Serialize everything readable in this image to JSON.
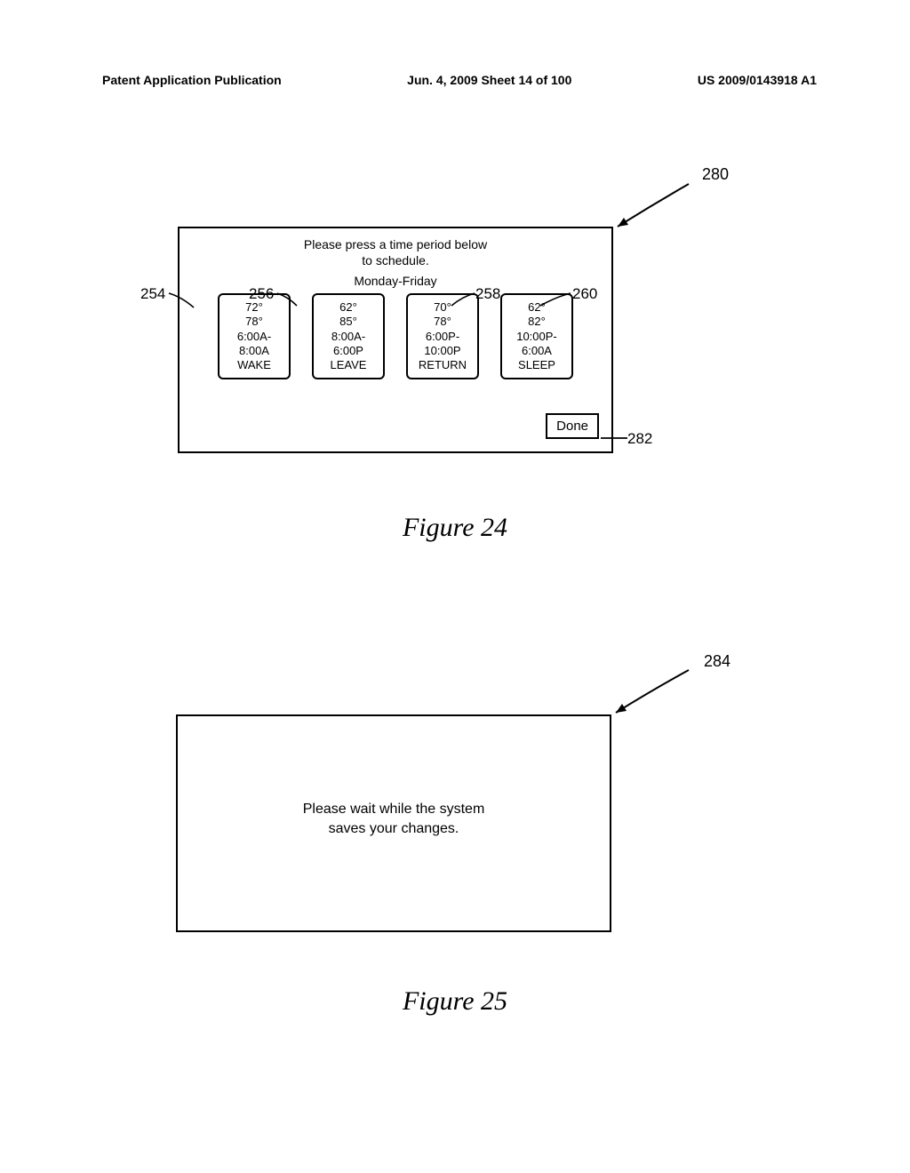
{
  "header": {
    "left": "Patent Application Publication",
    "mid": "Jun. 4, 2009  Sheet 14 of 100",
    "right": "US 2009/0143918 A1"
  },
  "fig24": {
    "ref": "280",
    "prompt_l1": "Please press a time period below",
    "prompt_l2": "to schedule.",
    "dayrange": "Monday-Friday",
    "periods": [
      {
        "ref": "254",
        "t1": "72°",
        "t2": "78°",
        "time1": "6:00A-",
        "time2": "8:00A",
        "label": "WAKE"
      },
      {
        "ref": "256",
        "t1": "62°",
        "t2": "85°",
        "time1": "8:00A-",
        "time2": "6:00P",
        "label": "LEAVE"
      },
      {
        "ref": "258",
        "t1": "70°",
        "t2": "78°",
        "time1": "6:00P-",
        "time2": "10:00P",
        "label": "RETURN"
      },
      {
        "ref": "260",
        "t1": "62°",
        "t2": "82°",
        "time1": "10:00P-",
        "time2": "6:00A",
        "label": "SLEEP"
      }
    ],
    "done": "Done",
    "done_ref": "282",
    "caption": "Figure 24"
  },
  "fig25": {
    "ref": "284",
    "msg_l1": "Please wait while the system",
    "msg_l2": "saves your changes.",
    "caption": "Figure 25"
  }
}
